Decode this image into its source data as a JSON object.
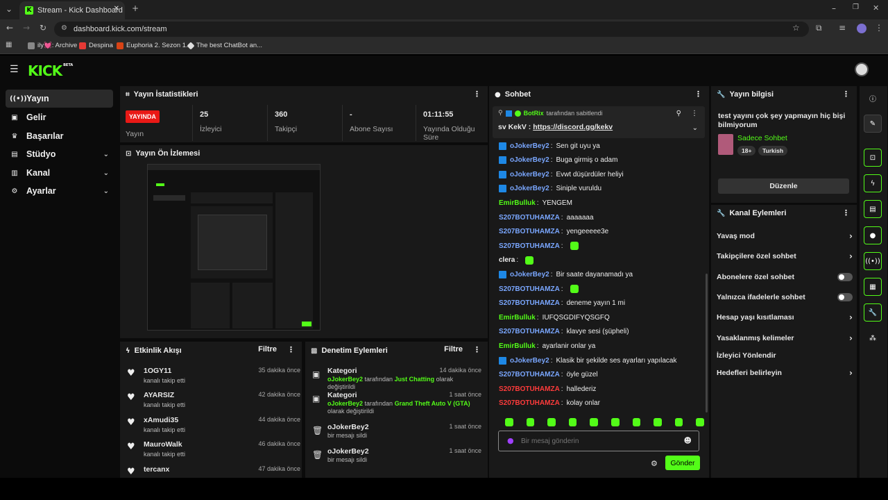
{
  "browser": {
    "tab_title": "Stream - Kick Dashboard",
    "url": "dashboard.kick.com/stream",
    "bookmarks": [
      "ily💓: Archive",
      "Despina",
      "Euphoria 2. Sezon 1....",
      "The best ChatBot an..."
    ]
  },
  "app": {
    "logo": "KICK",
    "logo_sup": "BETA"
  },
  "sidebar": {
    "items": [
      {
        "label": "Yayın",
        "icon": "broadcast-icon"
      },
      {
        "label": "Gelir",
        "icon": "wallet-icon"
      },
      {
        "label": "Başarılar",
        "icon": "trophy-icon"
      },
      {
        "label": "Stüdyo",
        "icon": "studio-icon"
      },
      {
        "label": "Kanal",
        "icon": "channel-icon"
      },
      {
        "label": "Ayarlar",
        "icon": "gear-icon"
      }
    ]
  },
  "stats": {
    "title": "Yayın İstatistikleri",
    "live_badge": "YAYINDA",
    "live_label": "Yayın",
    "cells": [
      {
        "value": "25",
        "label": "İzleyici"
      },
      {
        "value": "360",
        "label": "Takipçi"
      },
      {
        "value": "-",
        "label": "Abone Sayısı"
      },
      {
        "value": "01:11:55",
        "label": "Yayında Olduğu Süre"
      }
    ]
  },
  "preview": {
    "title": "Yayın Ön İzlemesi"
  },
  "activity": {
    "title": "Etkinlik Akışı",
    "filter": "Filtre",
    "items": [
      {
        "name": "1OGY11",
        "sub": "kanalı takip etti",
        "time": "35 dakika önce"
      },
      {
        "name": "AYARSIZ",
        "sub": "kanalı takip etti",
        "time": "42 dakika önce"
      },
      {
        "name": "xAmudi35",
        "sub": "kanalı takip etti",
        "time": "44 dakika önce"
      },
      {
        "name": "MauroWalk",
        "sub": "kanalı takip etti",
        "time": "46 dakika önce"
      },
      {
        "name": "tercanx",
        "sub": "",
        "time": "47 dakika önce"
      }
    ]
  },
  "moderation": {
    "title": "Denetim Eylemleri",
    "filter": "Filtre",
    "items": [
      {
        "title": "Kategori",
        "user": "oJokerBey2",
        "mid": " tarafından ",
        "cat": "Just Chatting",
        "tail": " olarak değiştirildi",
        "time": "14 dakika önce"
      },
      {
        "title": "Kategori",
        "user": "oJokerBey2",
        "mid": " tarafından ",
        "cat": "Grand Theft Auto V (GTA)",
        "tail": " olarak değiştirildi",
        "time": "1 saat önce"
      },
      {
        "title": "oJokerBey2",
        "desc": "bir mesajı sildi",
        "time": "1 saat önce"
      },
      {
        "title": "oJokerBey2",
        "desc": "bir mesajı sildi",
        "time": "1 saat önce"
      }
    ]
  },
  "chat": {
    "title": "Sohbet",
    "pinned_by": "BotRix",
    "pinned_suffix": "tarafından sabitlendi",
    "pinned_prefix": "sv KekV : ",
    "pinned_link": "https://discord.gg/kekv",
    "messages": [
      {
        "user": "oJokerBey2",
        "color": "#7aa7ff",
        "text": "Sen git uyu ya",
        "badge": true
      },
      {
        "user": "oJokerBey2",
        "color": "#7aa7ff",
        "text": "Buga girmiş o adam",
        "badge": true
      },
      {
        "user": "oJokerBey2",
        "color": "#7aa7ff",
        "text": "Evwt düşürdüler heliyi",
        "badge": true
      },
      {
        "user": "oJokerBey2",
        "color": "#7aa7ff",
        "text": "Siniple vuruldu",
        "badge": true
      },
      {
        "user": "EmirBulluk",
        "color": "#53fc18",
        "text": "YENGEM",
        "badge": false
      },
      {
        "user": "S207BOTUHAMZA",
        "color": "#7aa7ff",
        "text": "aaaaaaa",
        "badge": false
      },
      {
        "user": "S207BOTUHAMZA",
        "color": "#7aa7ff",
        "text": "yengeeeee3e",
        "badge": false
      },
      {
        "user": "S207BOTUHAMZA",
        "color": "#7aa7ff",
        "text": "",
        "badge": false,
        "emote": true
      },
      {
        "user": "clera",
        "color": "#eeeeee",
        "text": "",
        "badge": false,
        "emote": true
      },
      {
        "user": "oJokerBey2",
        "color": "#7aa7ff",
        "text": "Bir saate dayanamadı ya",
        "badge": true
      },
      {
        "user": "S207BOTUHAMZA",
        "color": "#7aa7ff",
        "text": "",
        "badge": false,
        "emote": true
      },
      {
        "user": "S207BOTUHAMZA",
        "color": "#7aa7ff",
        "text": "deneme yayın 1 mi",
        "badge": false
      },
      {
        "user": "EmirBulluk",
        "color": "#53fc18",
        "text": "IUFQSGDIFYQSGFQ",
        "badge": false
      },
      {
        "user": "S207BOTUHAMZA",
        "color": "#7aa7ff",
        "text": "klavye sesi (şüpheli)",
        "badge": false
      },
      {
        "user": "EmirBulluk",
        "color": "#53fc18",
        "text": "ayarlanir onlar ya",
        "badge": false
      },
      {
        "user": "oJokerBey2",
        "color": "#7aa7ff",
        "text": "Klasik bir şekilde ses ayarları yapılacak",
        "badge": true
      },
      {
        "user": "S207BOTUHAMZA",
        "color": "#7aa7ff",
        "text": "öyle güzel",
        "badge": false
      },
      {
        "user": "S207BOTUHAMZA",
        "color": "#ff3b3b",
        "text": "hallederiz",
        "badge": false
      },
      {
        "user": "S207BOTUHAMZA",
        "color": "#ff3b3b",
        "text": "kolay onlar",
        "badge": false
      }
    ],
    "placeholder": "Bir mesaj gönderin",
    "send": "Gönder"
  },
  "stream_info": {
    "title": "Yayın bilgisi",
    "stream_title": "test yayını çok şey yapmayın hiç bişi bilmiyorum",
    "category": "Sadece Sohbet",
    "tags": [
      "18+",
      "Turkish"
    ],
    "edit": "Düzenle"
  },
  "channel_actions": {
    "title": "Kanal Eylemleri",
    "items": [
      {
        "label": "Yavaş mod",
        "control": "chevron"
      },
      {
        "label": "Takipçilere özel sohbet",
        "control": "chevron"
      },
      {
        "label": "Abonelere özel sohbet",
        "control": "toggle"
      },
      {
        "label": "Yalnızca ifadelerle sohbet",
        "control": "toggle"
      },
      {
        "label": "Hesap yaşı kısıtlaması",
        "control": "chevron"
      },
      {
        "label": "Yasaklanmış kelimeler",
        "control": "chevron"
      },
      {
        "label": "İzleyici Yönlendir",
        "control": "none"
      },
      {
        "label": "Hedefleri belirleyin",
        "control": "chevron"
      }
    ]
  },
  "colors": {
    "accent": "#53fc18",
    "live": "#e91916",
    "panel": "#191919"
  }
}
